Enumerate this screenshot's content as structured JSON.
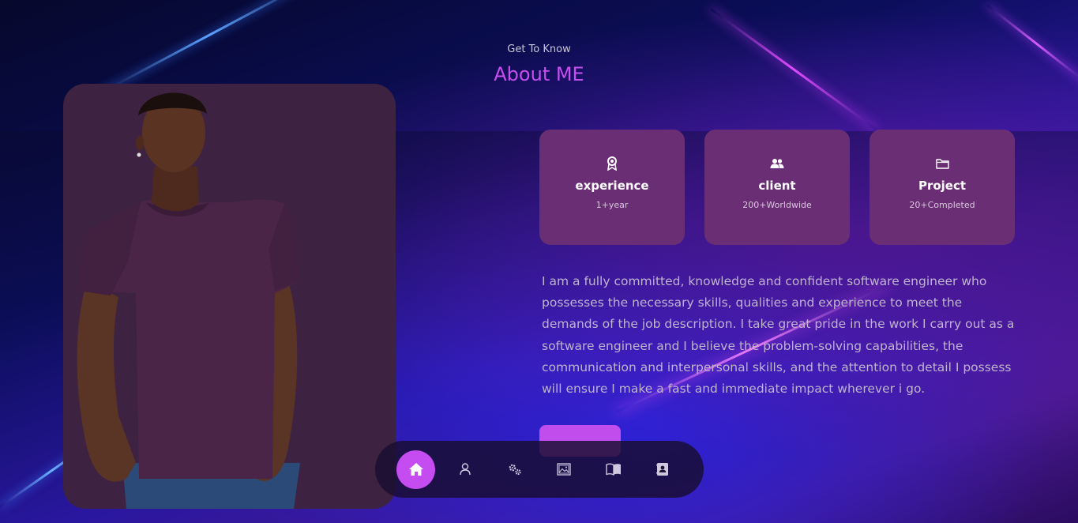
{
  "header": {
    "eyebrow": "Get To Know",
    "title": "About ME"
  },
  "stats": [
    {
      "icon": "award-icon",
      "label": "experience",
      "value": "1+year"
    },
    {
      "icon": "users-icon",
      "label": "client",
      "value": "200+Worldwide"
    },
    {
      "icon": "folder-icon",
      "label": "Project",
      "value": "20+Completed"
    }
  ],
  "about": {
    "text": "I am a fully committed, knowledge and confident software engineer who possesses the necessary skills, qualities and experience to meet the demands of the job description. I take great pride in the work I carry out as a software engineer and I believe the problem-solving capabilities, the communication and interpersonal skills, and the attention to detail I possess will ensure I make a fast and immediate impact wherever i go."
  },
  "nav": {
    "items": [
      {
        "icon": "home-icon",
        "active": true
      },
      {
        "icon": "user-icon",
        "active": false
      },
      {
        "icon": "gears-icon",
        "active": false
      },
      {
        "icon": "gallery-icon",
        "active": false
      },
      {
        "icon": "book-icon",
        "active": false
      },
      {
        "icon": "contact-icon",
        "active": false
      }
    ]
  },
  "colors": {
    "accent": "#c44cf0",
    "card": "#6a2e74",
    "photo_bg": "#3e2242"
  }
}
